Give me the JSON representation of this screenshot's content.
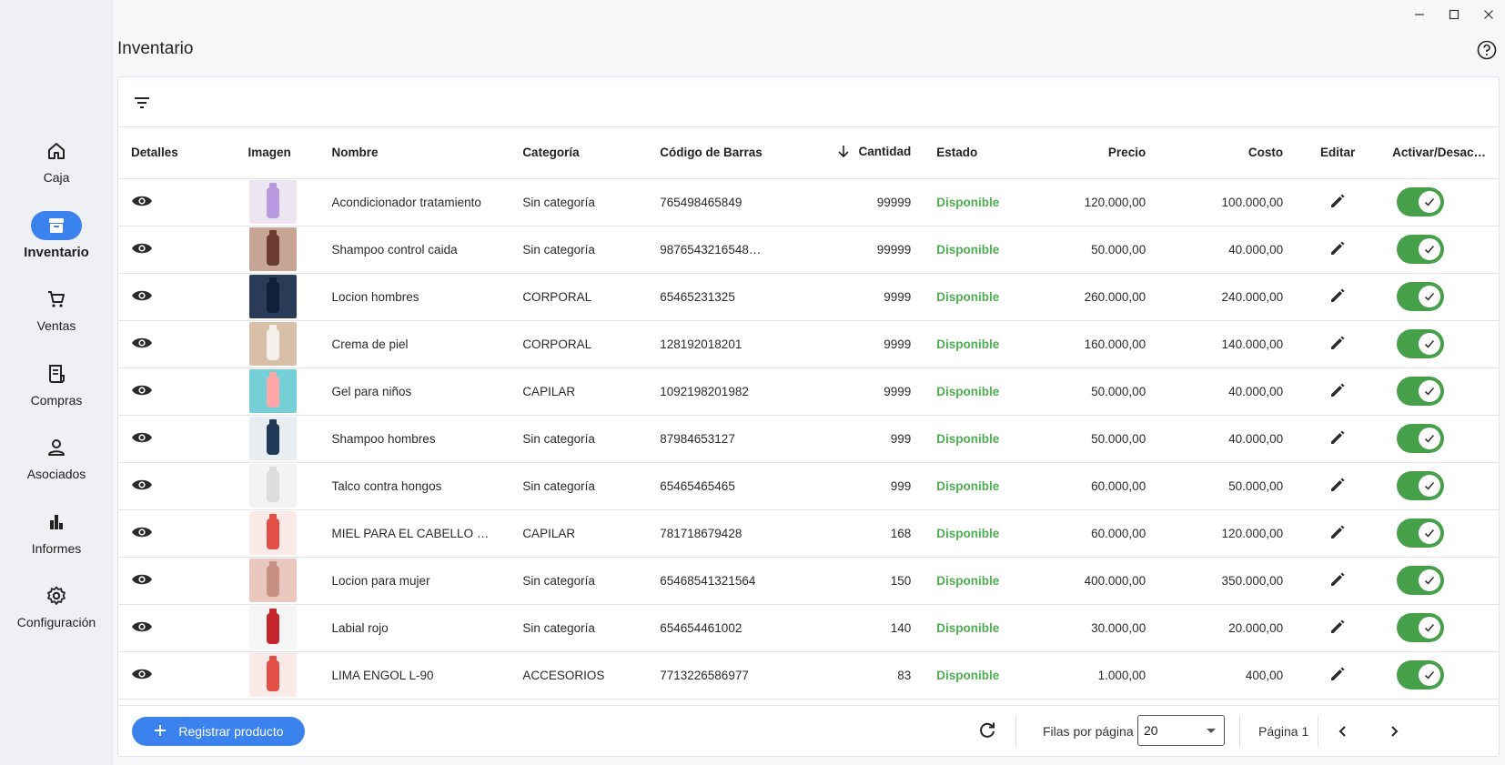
{
  "window": {
    "minimize": "minimize",
    "maximize": "maximize",
    "close": "close"
  },
  "sidebar": {
    "items": [
      {
        "label": "Caja",
        "icon": "home-icon",
        "active": false
      },
      {
        "label": "Inventario",
        "icon": "archive-icon",
        "active": true
      },
      {
        "label": "Ventas",
        "icon": "cart-icon",
        "active": false
      },
      {
        "label": "Compras",
        "icon": "receipt-icon",
        "active": false
      },
      {
        "label": "Asociados",
        "icon": "person-icon",
        "active": false
      },
      {
        "label": "Informes",
        "icon": "bar-chart-icon",
        "active": false
      },
      {
        "label": "Configuración",
        "icon": "gear-icon",
        "active": false
      }
    ]
  },
  "header": {
    "title": "Inventario"
  },
  "table": {
    "columns": {
      "detalles": "Detalles",
      "imagen": "Imagen",
      "nombre": "Nombre",
      "categoria": "Categoría",
      "codigo": "Código de Barras",
      "cantidad": "Cantidad",
      "estado": "Estado",
      "precio": "Precio",
      "costo": "Costo",
      "editar": "Editar",
      "activar": "Activar/Desactivar"
    },
    "sorted_by": "Cantidad",
    "sort_direction": "descending",
    "rows": [
      {
        "nombre": "Acondicionador tratamiento",
        "categoria": "Sin categoría",
        "codigo": "765498465849",
        "cantidad": "99999",
        "estado": "Disponible",
        "precio": "120.000,00",
        "costo": "100.000,00",
        "active": true
      },
      {
        "nombre": "Shampoo control caida",
        "categoria": "Sin categoría",
        "codigo": "9876543216548…",
        "cantidad": "99999",
        "estado": "Disponible",
        "precio": "50.000,00",
        "costo": "40.000,00",
        "active": true
      },
      {
        "nombre": "Locion hombres",
        "categoria": "CORPORAL",
        "codigo": "65465231325",
        "cantidad": "9999",
        "estado": "Disponible",
        "precio": "260.000,00",
        "costo": "240.000,00",
        "active": true
      },
      {
        "nombre": "Crema de piel",
        "categoria": "CORPORAL",
        "codigo": "128192018201",
        "cantidad": "9999",
        "estado": "Disponible",
        "precio": "160.000,00",
        "costo": "140.000,00",
        "active": true
      },
      {
        "nombre": "Gel para niños",
        "categoria": "CAPILAR",
        "codigo": "1092198201982",
        "cantidad": "9999",
        "estado": "Disponible",
        "precio": "50.000,00",
        "costo": "40.000,00",
        "active": true
      },
      {
        "nombre": "Shampoo hombres",
        "categoria": "Sin categoría",
        "codigo": "87984653127",
        "cantidad": "999",
        "estado": "Disponible",
        "precio": "50.000,00",
        "costo": "40.000,00",
        "active": true
      },
      {
        "nombre": "Talco contra hongos",
        "categoria": "Sin categoría",
        "codigo": "65465465465",
        "cantidad": "999",
        "estado": "Disponible",
        "precio": "60.000,00",
        "costo": "50.000,00",
        "active": true
      },
      {
        "nombre": "MIEL PARA EL CABELLO …",
        "categoria": "CAPILAR",
        "codigo": "781718679428",
        "cantidad": "168",
        "estado": "Disponible",
        "precio": "60.000,00",
        "costo": "120.000,00",
        "active": true
      },
      {
        "nombre": "Locion para mujer",
        "categoria": "Sin categoría",
        "codigo": "65468541321564",
        "cantidad": "150",
        "estado": "Disponible",
        "precio": "400.000,00",
        "costo": "350.000,00",
        "active": true
      },
      {
        "nombre": "Labial rojo",
        "categoria": "Sin categoría",
        "codigo": "654654461002",
        "cantidad": "140",
        "estado": "Disponible",
        "precio": "30.000,00",
        "costo": "20.000,00",
        "active": true
      },
      {
        "nombre": "LIMA ENGOL L-90",
        "categoria": "ACCESORIOS",
        "codigo": "7713226586977",
        "cantidad": "83",
        "estado": "Disponible",
        "precio": "1.000,00",
        "costo": "400,00",
        "active": true
      }
    ]
  },
  "footer": {
    "register_label": "Registrar producto",
    "rows_per_page_label": "Filas por página",
    "rows_per_page_value": "20",
    "page_label": "Página 1"
  },
  "colors": {
    "accent": "#3c82ee",
    "status_available": "#4caf50",
    "toggle_on": "#45a049"
  }
}
